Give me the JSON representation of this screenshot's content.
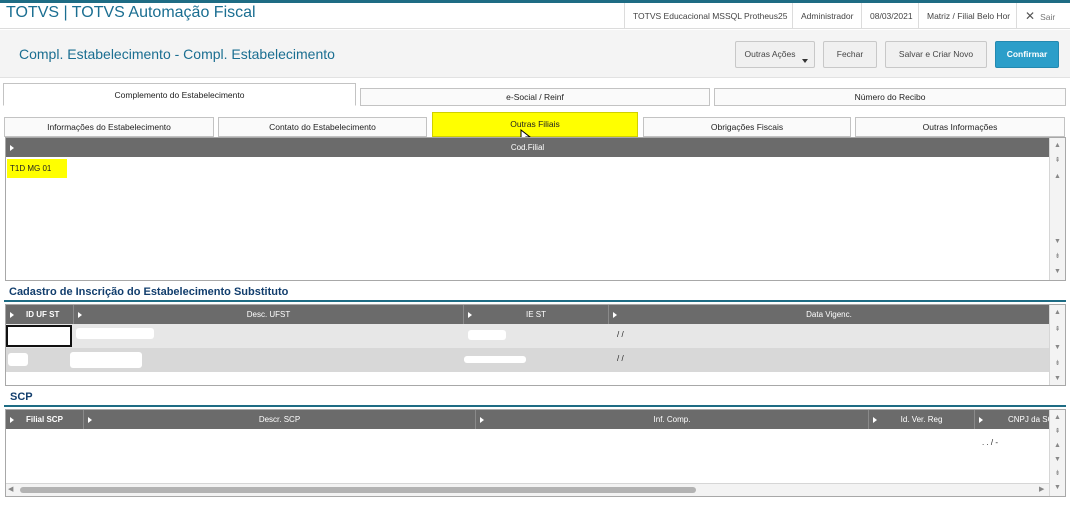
{
  "app": {
    "title": "TOTVS | TOTVS Automação Fiscal",
    "environment": "TOTVS Educacional MSSQL Protheus25",
    "user": "Administrador",
    "date": "08/03/2021",
    "branch": "Matriz / Filial Belo Hor",
    "exit_label": "Sair"
  },
  "page": {
    "title": "Compl. Estabelecimento - Compl. Estabelecimento"
  },
  "toolbar": {
    "other_actions": "Outras Ações",
    "close": "Fechar",
    "save_new": "Salvar e Criar Novo",
    "confirm": "Confirmar"
  },
  "tabs_main": [
    "Complemento do Estabelecimento",
    "e-Social / Reinf",
    "Número do Recibo"
  ],
  "tabs_sub": [
    "Informações do Estabelecimento",
    "Contato do Estabelecimento",
    "Outras Filiais",
    "Obrigações Fiscais",
    "Outras Informações"
  ],
  "grid_filiais": {
    "header": "Cod.Filial",
    "rows": [
      "T1D MG 01"
    ]
  },
  "section_substituto": {
    "title": "Cadastro de Inscrição do Estabelecimento Substituto",
    "columns": [
      "ID UF ST",
      "Desc. UFST",
      "IE ST",
      "Data Vigenc."
    ],
    "rows": [
      {
        "date": "/ /"
      },
      {
        "date": "/ /"
      }
    ]
  },
  "section_scp": {
    "title": "SCP",
    "columns": [
      "Filial SCP",
      "Descr. SCP",
      "Inf. Comp.",
      "Id. Ver. Reg",
      "CNPJ da SC"
    ],
    "row_value": ". . / -"
  },
  "colors": {
    "accent": "#1a6e91",
    "primary_button": "#2b9ec9",
    "highlight": "#ffff00",
    "grid_header": "#6b6b6b"
  }
}
